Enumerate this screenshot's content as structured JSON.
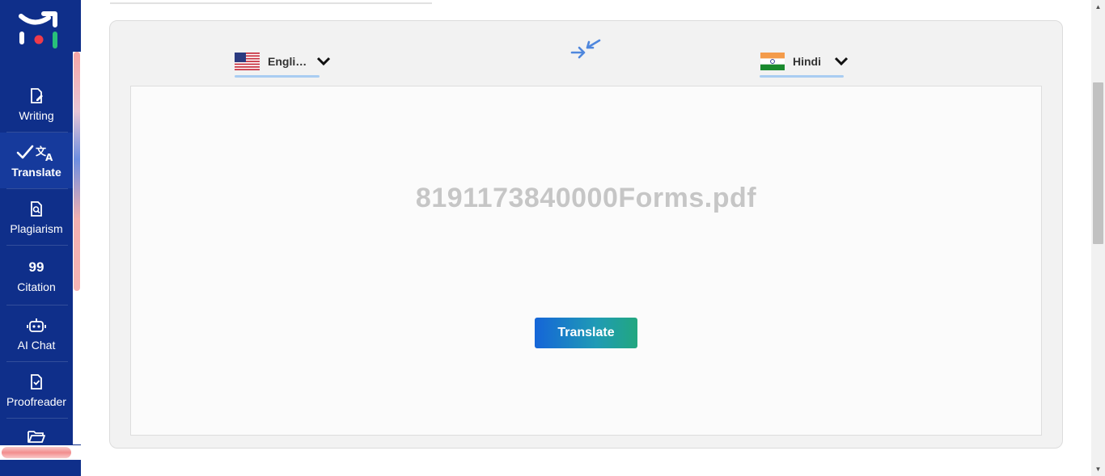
{
  "sidebar": {
    "items": [
      {
        "label": "Writing",
        "icon": "document-edit-icon"
      },
      {
        "label": "Translate",
        "icon": "translate-icon",
        "active": true
      },
      {
        "label": "Plagiarism",
        "icon": "document-search-icon"
      },
      {
        "label": "Citation",
        "icon": "quote-icon",
        "glyph": "99"
      },
      {
        "label": "AI Chat",
        "icon": "robot-icon"
      },
      {
        "label": "Proofreader",
        "icon": "document-check-icon"
      },
      {
        "label": "",
        "icon": "folder-icon"
      }
    ]
  },
  "translator": {
    "source_language": "Engli…",
    "target_language": "Hindi",
    "file_name": "8191173840000Forms.pdf",
    "translate_button": "Translate"
  },
  "colors": {
    "sidebar_bg": "#0f2f8a",
    "accent_blue": "#1565d8",
    "accent_green": "#22a77f",
    "underline": "#a9cdf2"
  }
}
